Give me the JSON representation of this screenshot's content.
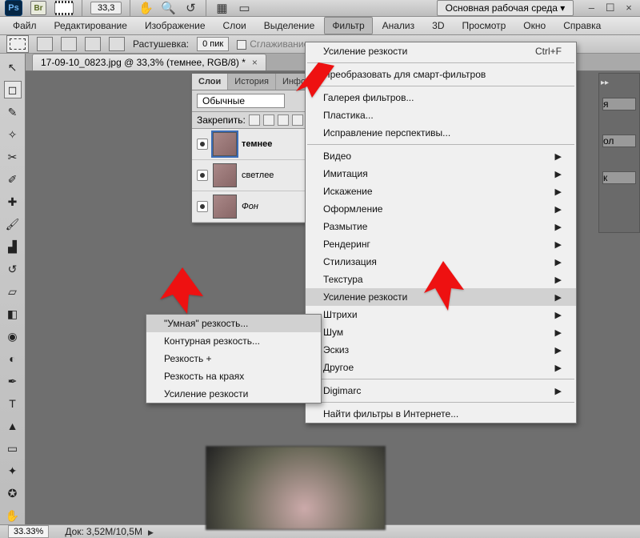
{
  "app": {
    "workspace_label": "Основная рабочая среда ▾",
    "ps_badge": "Ps",
    "br_badge": "Br",
    "zoom_field": "33,3",
    "win_min": "–",
    "win_rest": "☐",
    "win_close": "×"
  },
  "menu": {
    "file": "Файл",
    "edit": "Редактирование",
    "image": "Изображение",
    "layer": "Слои",
    "select": "Выделение",
    "filter": "Фильтр",
    "analysis": "Анализ",
    "threeD": "3D",
    "view": "Просмотр",
    "window": "Окно",
    "help": "Справка"
  },
  "optbar": {
    "feather_label": "Растушевка:",
    "feather_value": "0 пик",
    "antialias_label": "Сглаживание"
  },
  "doc": {
    "tab_title": "17-09-10_0823.jpg @ 33,3% (темнее, RGB/8) *",
    "tab_close": "×"
  },
  "layers_panel": {
    "tabs": {
      "layers": "Слои",
      "history": "История",
      "info": "Инфо"
    },
    "blend_mode": "Обычные",
    "lock_label": "Закрепить:",
    "layers": [
      {
        "name": "темнее",
        "active": true,
        "italic": false
      },
      {
        "name": "светлее",
        "active": false,
        "italic": false
      },
      {
        "name": "Фон",
        "active": false,
        "italic": true
      }
    ]
  },
  "filters_menu": {
    "last": "Усиление резкости",
    "last_shortcut": "Ctrl+F",
    "smart": "Преобразовать для смарт-фильтров",
    "gallery": "Галерея фильтров...",
    "liquify": "Пластика...",
    "vanish": "Исправление перспективы...",
    "cats": {
      "video": "Видео",
      "artistic": "Имитация",
      "distort": "Искажение",
      "stylize2": "Оформление",
      "blur": "Размытие",
      "render": "Рендеринг",
      "stylize": "Стилизация",
      "texture": "Текстура",
      "sharpen": "Усиление резкости",
      "strokes": "Штрихи",
      "noise": "Шум",
      "sketch": "Эскиз",
      "other": "Другое"
    },
    "digimarc": "Digimarc",
    "online": "Найти фильтры в Интернете..."
  },
  "sharpen_submenu": {
    "smart_sharpen": "\"Умная\" резкость...",
    "edge_sharpen": "Контурная резкость...",
    "sharpen_more": "Резкость +",
    "sharpen_edges": "Резкость на краях",
    "sharpen": "Усиление резкости"
  },
  "rightdock": {
    "items": [
      "я",
      "ол",
      "к"
    ]
  },
  "status": {
    "zoom": "33.33%",
    "doc_label": "Док:",
    "doc_value": "3,52M/10,5M"
  }
}
